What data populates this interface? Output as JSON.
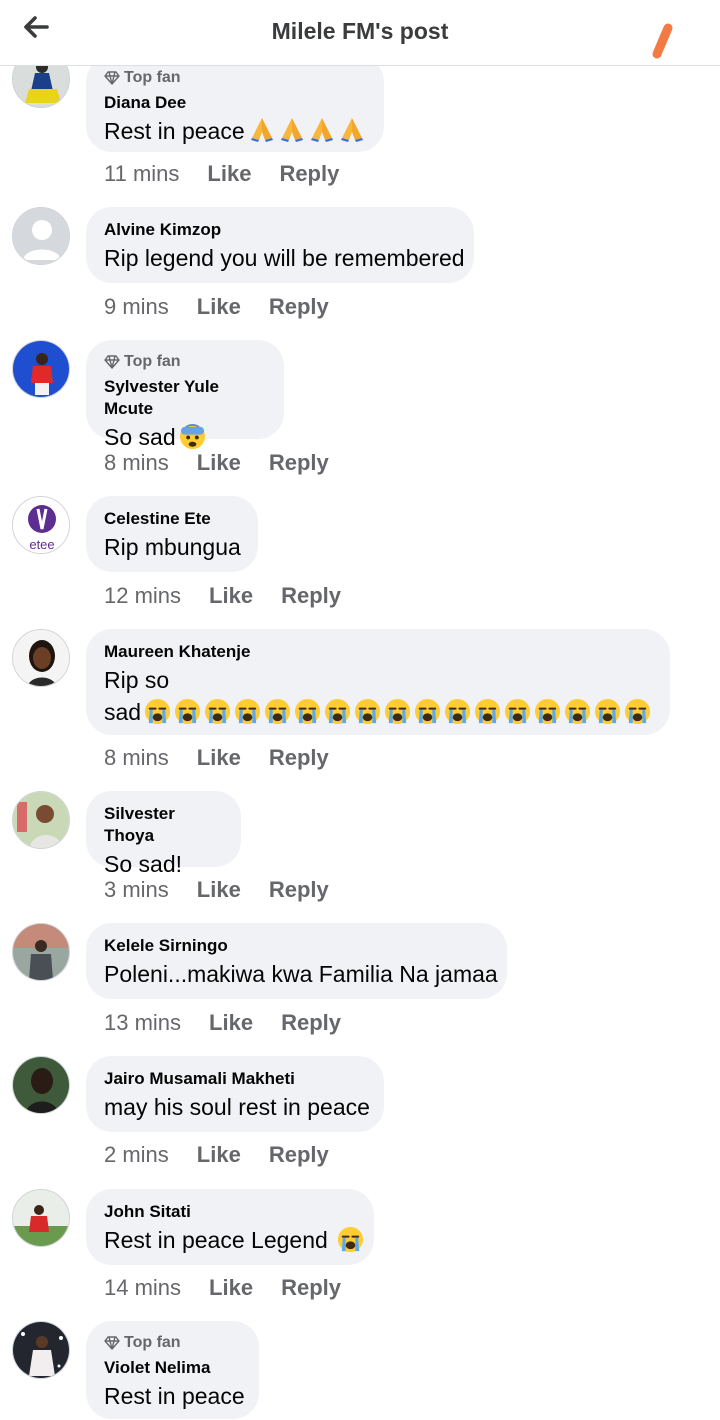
{
  "header": {
    "title": "Milele FM's post",
    "back_icon": "arrow-left-icon",
    "accent": "#f47a45"
  },
  "comments": [
    {
      "author": "Diana Dee",
      "top_fan": true,
      "top_fan_label": "Top fan",
      "text": "Rest in peace",
      "emoji": "praying-hands-x4",
      "time": "11 mins",
      "like": "Like",
      "reply": "Reply"
    },
    {
      "author": "Alvine Kimzop",
      "top_fan": false,
      "text": "Rip legend you will be remembered",
      "time": "9 mins",
      "like": "Like",
      "reply": "Reply"
    },
    {
      "author": "Sylvester Yule Mcute",
      "top_fan": true,
      "top_fan_label": "Top fan",
      "text": "So sad",
      "emoji": "anxious-face",
      "time": "8 mins",
      "like": "Like",
      "reply": "Reply"
    },
    {
      "author": "Celestine Ete",
      "top_fan": false,
      "avatar_text": "etee",
      "text": "Rip mbungua",
      "time": "12 mins",
      "like": "Like",
      "reply": "Reply"
    },
    {
      "author": "Maureen Khatenje",
      "top_fan": false,
      "text_line1": "Rip so",
      "text_line2": "sad",
      "emoji": "crying-face-x17",
      "time": "8 mins",
      "like": "Like",
      "reply": "Reply"
    },
    {
      "author": "Silvester Thoya",
      "top_fan": false,
      "text": "So sad!",
      "time": "3 mins",
      "like": "Like",
      "reply": "Reply"
    },
    {
      "author": "Kelele Sirningo",
      "top_fan": false,
      "text": "Poleni...makiwa kwa Familia Na jamaa",
      "time": "13 mins",
      "like": "Like",
      "reply": "Reply"
    },
    {
      "author": "Jairo Musamali Makheti",
      "top_fan": false,
      "text": "may his soul rest in peace",
      "time": "2 mins",
      "like": "Like",
      "reply": "Reply"
    },
    {
      "author": "John Sitati",
      "top_fan": false,
      "text": "Rest in peace Legend",
      "emoji": "crying-face",
      "time": "14 mins",
      "like": "Like",
      "reply": "Reply"
    },
    {
      "author": "Violet Nelima",
      "top_fan": true,
      "top_fan_label": "Top fan",
      "text": "Rest in peace"
    }
  ]
}
